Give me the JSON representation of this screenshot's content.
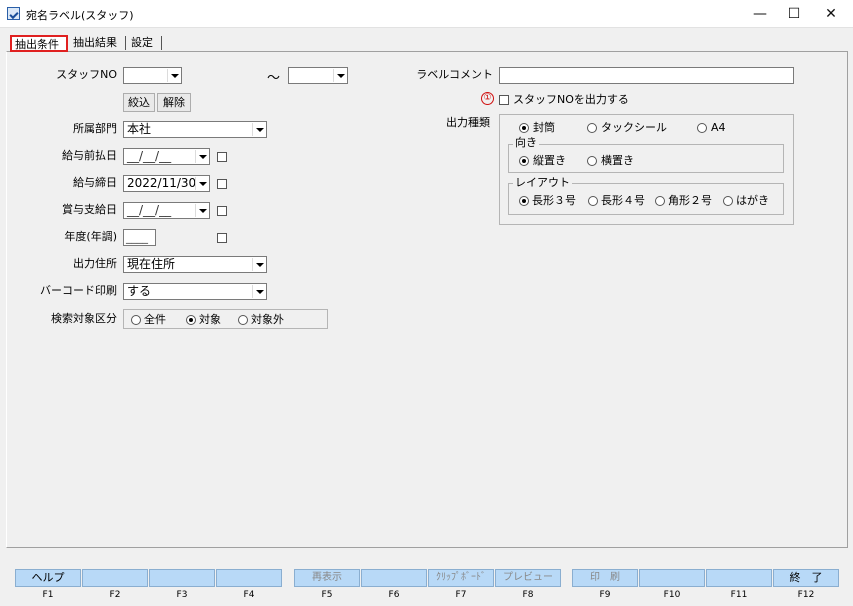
{
  "window": {
    "title": "宛名ラベル(スタッフ)",
    "min": "—",
    "max": "☐",
    "close": "✕"
  },
  "tabs": [
    "抽出条件",
    "抽出結果",
    "設定"
  ],
  "form": {
    "staff_no_label": "スタッフNO",
    "tilde": "～",
    "filter_btn": "絞込",
    "clear_btn": "解除",
    "dept_label": "所属部門",
    "dept_value": "本社",
    "pay_advance_label": "給与前払日",
    "pay_advance_value": "__/__/__",
    "pay_close_label": "給与締日",
    "pay_close_value": "2022/11/30",
    "bonus_label": "賞与支給日",
    "bonus_value": "__/__/__",
    "year_label": "年度(年調)",
    "year_value": "____",
    "address_label": "出力住所",
    "address_value": "現在住所",
    "barcode_label": "バーコード印刷",
    "barcode_value": "する",
    "search_label": "検索対象区分",
    "search_options": [
      "全件",
      "対象",
      "対象外"
    ]
  },
  "right": {
    "comment_label": "ラベルコメント",
    "comment_value": "",
    "marker": "①",
    "staffno_check": "スタッフNOを出力する",
    "output_type_label": "出力種類",
    "output_types": [
      "封筒",
      "タックシール",
      "A4"
    ],
    "orientation_title": "向き",
    "orientations": [
      "縦置き",
      "横置き"
    ],
    "layout_title": "レイアウト",
    "layouts": [
      "長形３号",
      "長形４号",
      "角形２号",
      "はがき"
    ]
  },
  "fkeys": [
    {
      "label": "ヘルプ",
      "key": "F1"
    },
    {
      "label": "",
      "key": "F2"
    },
    {
      "label": "",
      "key": "F3"
    },
    {
      "label": "",
      "key": "F4"
    },
    {
      "label": "再表示",
      "key": "F5"
    },
    {
      "label": "",
      "key": "F6"
    },
    {
      "label": "ｸﾘｯﾌﾟﾎﾞｰﾄﾞ",
      "key": "F7"
    },
    {
      "label": "プレビュー",
      "key": "F8"
    },
    {
      "label": "印　刷",
      "key": "F9"
    },
    {
      "label": "",
      "key": "F10"
    },
    {
      "label": "",
      "key": "F11"
    },
    {
      "label": "終　了",
      "key": "F12"
    }
  ]
}
